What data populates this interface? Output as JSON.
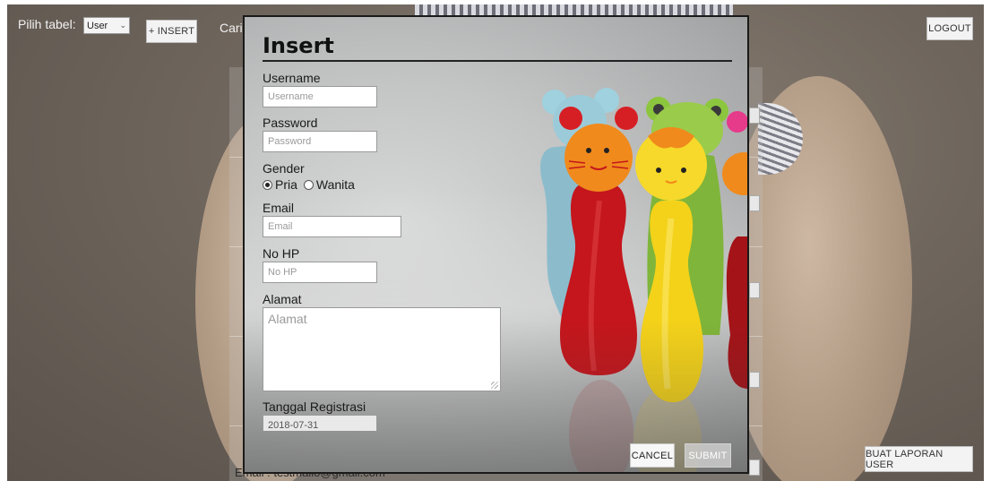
{
  "background": {
    "table_label": "Pilih tabel:",
    "table_select_value": "User",
    "insert_button": "+ INSERT",
    "search_label": "Cari",
    "logout_button": "LOGOUT",
    "report_button": "BUAT LAPORAN USER",
    "email_row_text": "Email : testmailo@gmail.com"
  },
  "modal": {
    "title": "Insert",
    "fields": {
      "username": {
        "label": "Username",
        "placeholder": "Username"
      },
      "password": {
        "label": "Password",
        "placeholder": "Password"
      },
      "gender": {
        "label": "Gender",
        "options": [
          "Pria",
          "Wanita"
        ],
        "selected": "Pria"
      },
      "email": {
        "label": "Email",
        "placeholder": "Email"
      },
      "phone": {
        "label": "No HP",
        "placeholder": "No HP"
      },
      "address": {
        "label": "Alamat",
        "placeholder": "Alamat"
      },
      "reg_date": {
        "label": "Tanggal Registrasi",
        "value": "2018-07-31"
      }
    },
    "cancel_button": "CANCEL",
    "submit_button": "SUBMIT"
  },
  "colors": {
    "overlay_dim": "#6f665d",
    "modal_border": "#1a1a1a",
    "toy_red": "#c4161c",
    "toy_yellow": "#f4d21a",
    "toy_blue": "#8fc3d3",
    "toy_orange": "#f08a1c",
    "toy_green": "#8cc63e"
  }
}
